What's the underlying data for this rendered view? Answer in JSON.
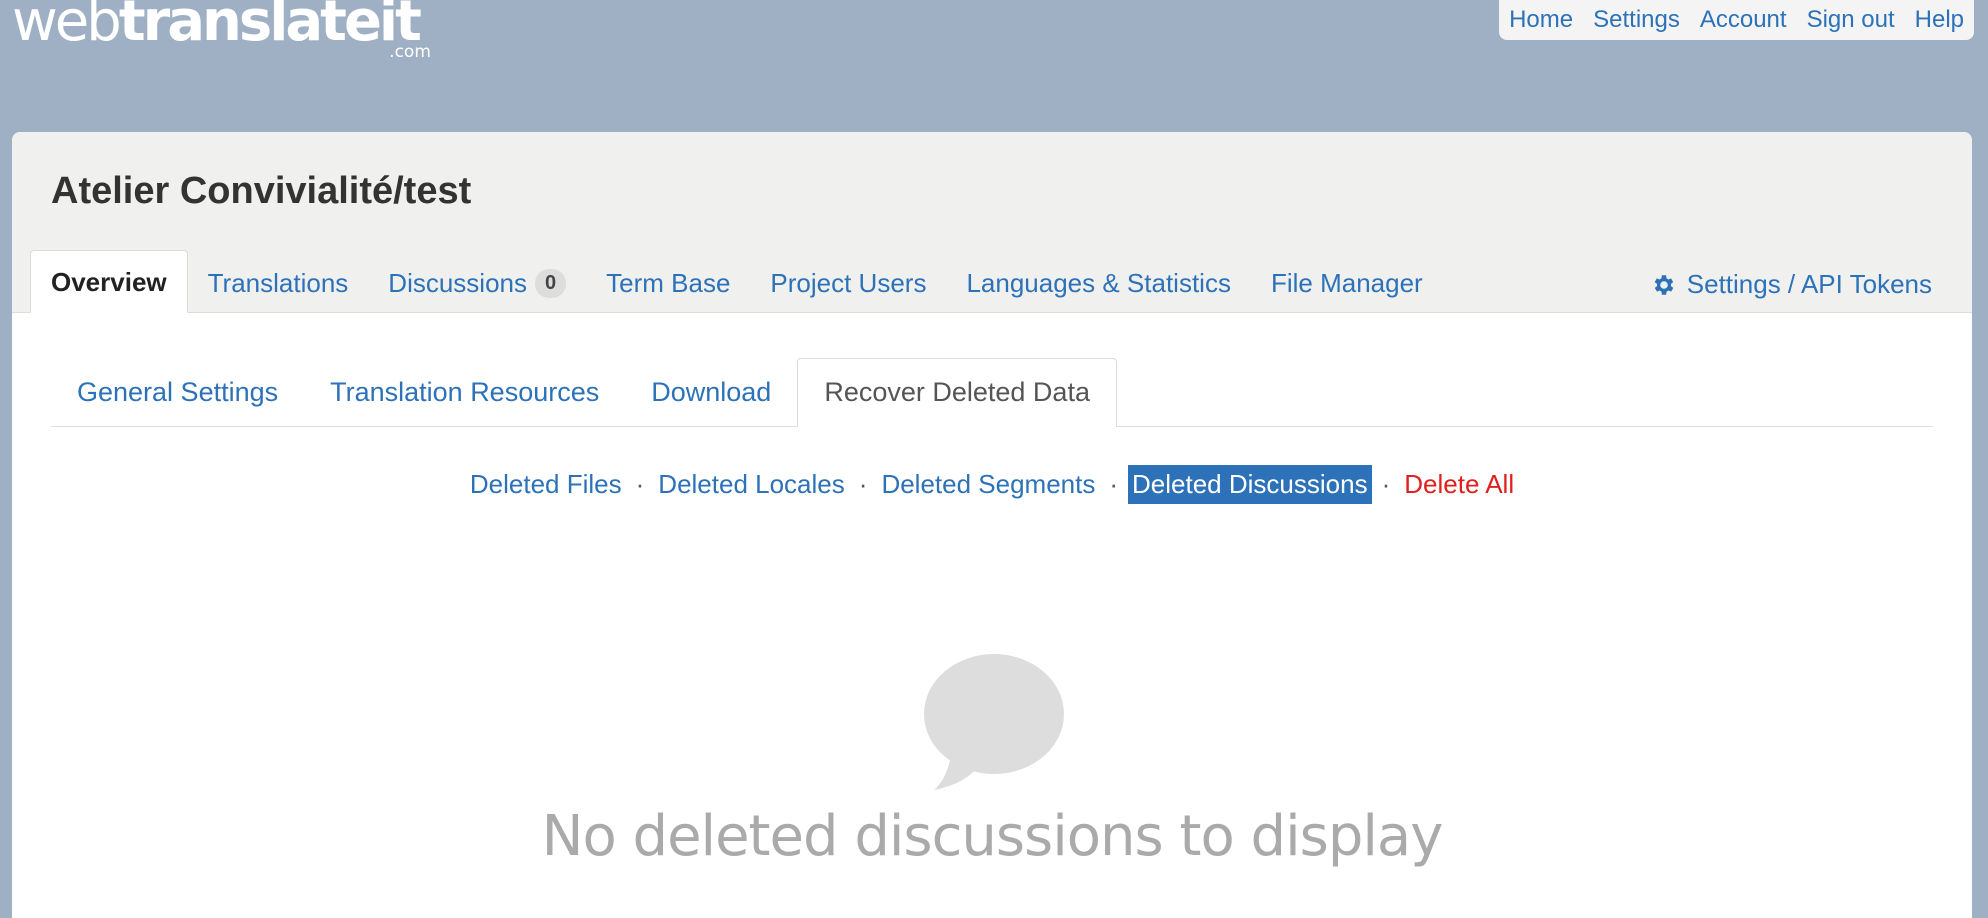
{
  "logo": {
    "part1": "web",
    "part2": "translateit",
    "suffix": ".com"
  },
  "topnav": [
    "Home",
    "Settings",
    "Account",
    "Sign out",
    "Help"
  ],
  "project": {
    "title": "Atelier Convivialité/test"
  },
  "main_tabs": [
    {
      "label": "Overview",
      "active": true
    },
    {
      "label": "Translations"
    },
    {
      "label": "Discussions",
      "badge": "0"
    },
    {
      "label": "Term Base"
    },
    {
      "label": "Project Users"
    },
    {
      "label": "Languages & Statistics"
    },
    {
      "label": "File Manager"
    }
  ],
  "settings_link": {
    "label": "Settings / API Tokens",
    "icon": "gear-icon"
  },
  "sub_tabs": [
    {
      "label": "General Settings"
    },
    {
      "label": "Translation Resources"
    },
    {
      "label": "Download"
    },
    {
      "label": "Recover Deleted Data",
      "active": true
    }
  ],
  "recover_links": [
    {
      "label": "Deleted Files"
    },
    {
      "label": "Deleted Locales"
    },
    {
      "label": "Deleted Segments"
    },
    {
      "label": "Deleted Discussions",
      "selected": true
    },
    {
      "label": "Delete All",
      "danger": true
    }
  ],
  "empty_state": {
    "icon": "speech-bubble-icon",
    "message": "No deleted discussions to display"
  },
  "colors": {
    "link": "#2d72b8",
    "danger": "#e0201d",
    "background": "#9fb0c5",
    "muted": "#aaaaaa"
  }
}
